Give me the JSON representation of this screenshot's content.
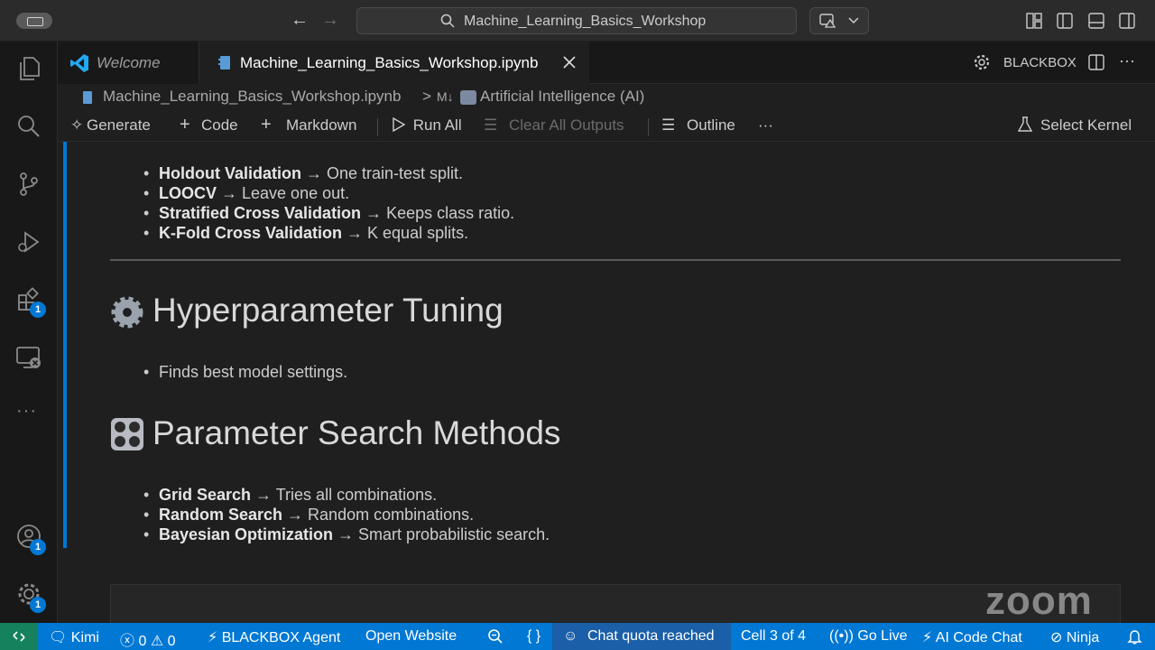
{
  "titlebar": {
    "search_text": "Machine_Learning_Basics_Workshop"
  },
  "tabs": {
    "welcome": "Welcome",
    "active": "Machine_Learning_Basics_Workshop.ipynb",
    "right_label": "BLACKBOX"
  },
  "breadcrumb": {
    "file": "Machine_Learning_Basics_Workshop.ipynb",
    "sep": ">",
    "md": "M↓",
    "section": "Artificial Intelligence (AI)"
  },
  "toolbar": {
    "generate": "Generate",
    "code": "Code",
    "markdown": "Markdown",
    "run_all": "Run All",
    "clear_outputs": "Clear All Outputs",
    "outline": "Outline",
    "more": "···",
    "select_kernel": "Select Kernel"
  },
  "content": {
    "validation_items": [
      {
        "term": "Holdout Validation",
        "desc": " → One train-test split."
      },
      {
        "term": "LOOCV",
        "desc": " → Leave one out."
      },
      {
        "term": "Stratified Cross Validation",
        "desc": " → Keeps class ratio."
      },
      {
        "term": "K-Fold Cross Validation",
        "desc": " → K equal splits."
      }
    ],
    "h_tuning": "Hyperparameter Tuning",
    "tuning_item": "Finds best model settings.",
    "h_search": "Parameter Search Methods",
    "search_items": [
      {
        "term": "Grid Search",
        "desc": " → Tries all combinations."
      },
      {
        "term": "Random Search",
        "desc": " → Random combinations."
      },
      {
        "term": "Bayesian Optimization",
        "desc": " → Smart probabilistic search."
      }
    ],
    "watermark": "zoom"
  },
  "activity": {
    "extensions_badge": "1",
    "accounts_badge": "1",
    "settings_badge": "1"
  },
  "statusbar": {
    "kimi": "Kimi",
    "errors": "0",
    "warnings": "0",
    "blackbox_agent": "BLACKBOX Agent",
    "open_website": "Open Website",
    "braces": "{ }",
    "chat_quota": "Chat quota reached",
    "cell": "Cell 3 of 4",
    "go_live": "Go Live",
    "ai_code_chat": "AI Code Chat",
    "ninja": "Ninja"
  },
  "colors": {
    "accent": "#0078d4",
    "remote": "#16825d",
    "background": "#1f1f1f"
  }
}
